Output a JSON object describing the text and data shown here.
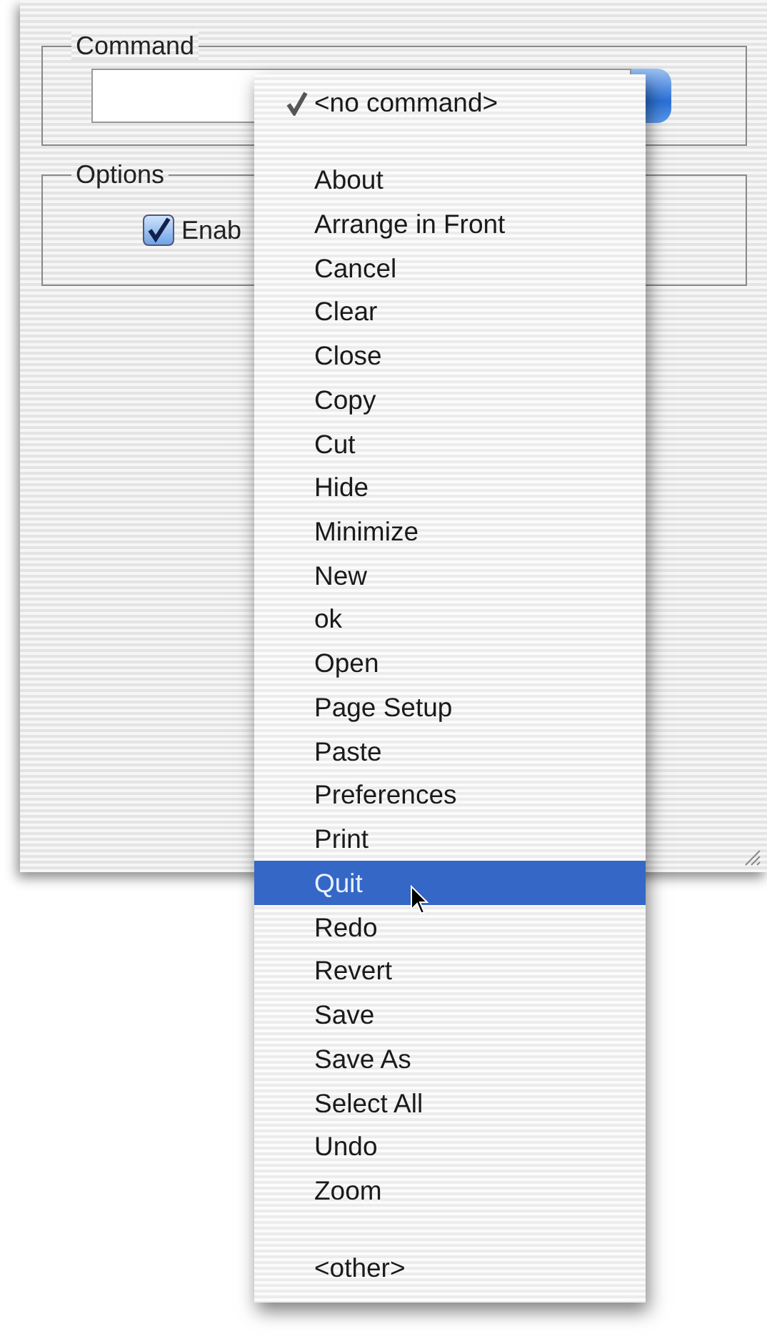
{
  "window": {
    "command_group": {
      "label": "Command"
    },
    "options_group": {
      "label": "Options",
      "checkboxes": [
        {
          "label": "Enab",
          "checked": true
        }
      ]
    }
  },
  "popup_menu": {
    "items": [
      {
        "kind": "item",
        "label": "<no command>",
        "checked": true,
        "selected": false
      },
      {
        "kind": "separator"
      },
      {
        "kind": "item",
        "label": "About",
        "checked": false,
        "selected": false
      },
      {
        "kind": "item",
        "label": "Arrange in Front",
        "checked": false,
        "selected": false
      },
      {
        "kind": "item",
        "label": "Cancel",
        "checked": false,
        "selected": false
      },
      {
        "kind": "item",
        "label": "Clear",
        "checked": false,
        "selected": false
      },
      {
        "kind": "item",
        "label": "Close",
        "checked": false,
        "selected": false
      },
      {
        "kind": "item",
        "label": "Copy",
        "checked": false,
        "selected": false
      },
      {
        "kind": "item",
        "label": "Cut",
        "checked": false,
        "selected": false
      },
      {
        "kind": "item",
        "label": "Hide",
        "checked": false,
        "selected": false
      },
      {
        "kind": "item",
        "label": "Minimize",
        "checked": false,
        "selected": false
      },
      {
        "kind": "item",
        "label": "New",
        "checked": false,
        "selected": false
      },
      {
        "kind": "item",
        "label": "ok",
        "checked": false,
        "selected": false
      },
      {
        "kind": "item",
        "label": "Open",
        "checked": false,
        "selected": false
      },
      {
        "kind": "item",
        "label": "Page Setup",
        "checked": false,
        "selected": false
      },
      {
        "kind": "item",
        "label": "Paste",
        "checked": false,
        "selected": false
      },
      {
        "kind": "item",
        "label": "Preferences",
        "checked": false,
        "selected": false
      },
      {
        "kind": "item",
        "label": "Print",
        "checked": false,
        "selected": false
      },
      {
        "kind": "item",
        "label": "Quit",
        "checked": false,
        "selected": true
      },
      {
        "kind": "item",
        "label": "Redo",
        "checked": false,
        "selected": false
      },
      {
        "kind": "item",
        "label": "Revert",
        "checked": false,
        "selected": false
      },
      {
        "kind": "item",
        "label": "Save",
        "checked": false,
        "selected": false
      },
      {
        "kind": "item",
        "label": "Save As",
        "checked": false,
        "selected": false
      },
      {
        "kind": "item",
        "label": "Select All",
        "checked": false,
        "selected": false
      },
      {
        "kind": "item",
        "label": "Undo",
        "checked": false,
        "selected": false
      },
      {
        "kind": "item",
        "label": "Zoom",
        "checked": false,
        "selected": false
      },
      {
        "kind": "separator"
      },
      {
        "kind": "item",
        "label": "<other>",
        "checked": false,
        "selected": false
      }
    ]
  }
}
